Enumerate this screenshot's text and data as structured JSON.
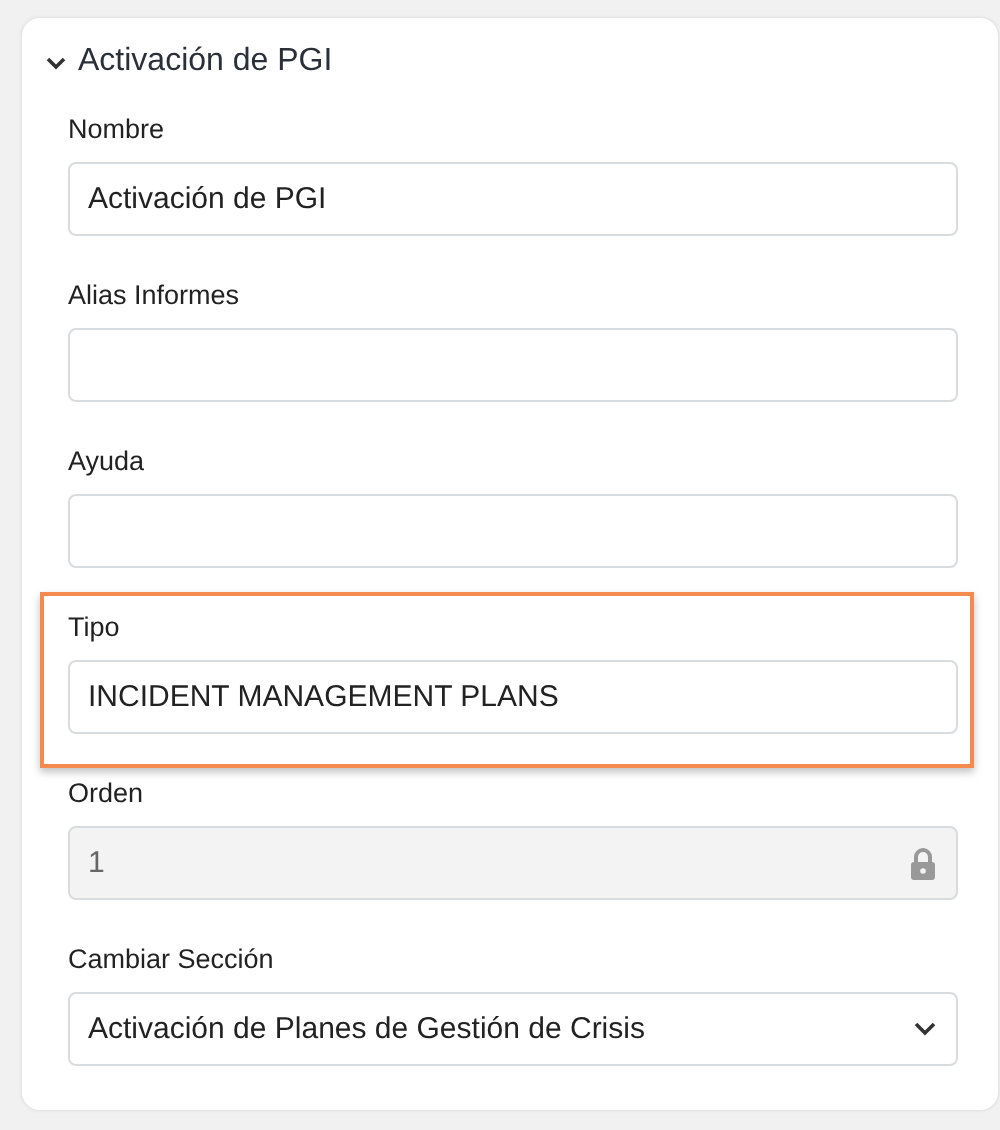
{
  "section": {
    "title": "Activación de PGI",
    "expanded": true,
    "fields": [
      {
        "label": "Nombre",
        "kind": "text",
        "value": "Activación de PGI",
        "disabled": false,
        "highlighted": false
      },
      {
        "label": "Alias Informes",
        "kind": "text",
        "disabled": false,
        "highlighted": false
      },
      {
        "label": "Ayuda",
        "kind": "text",
        "disabled": false,
        "highlighted": false
      },
      {
        "label": "Tipo",
        "kind": "text",
        "value": "INCIDENT MANAGEMENT PLANS",
        "disabled": false,
        "highlighted": true
      },
      {
        "label": "Orden",
        "kind": "text",
        "value": "1",
        "disabled": true,
        "highlighted": false
      },
      {
        "label": "Cambiar Sección",
        "kind": "select",
        "value": "Activación de Planes de Gestión de Crisis",
        "disabled": false,
        "highlighted": false
      }
    ]
  }
}
